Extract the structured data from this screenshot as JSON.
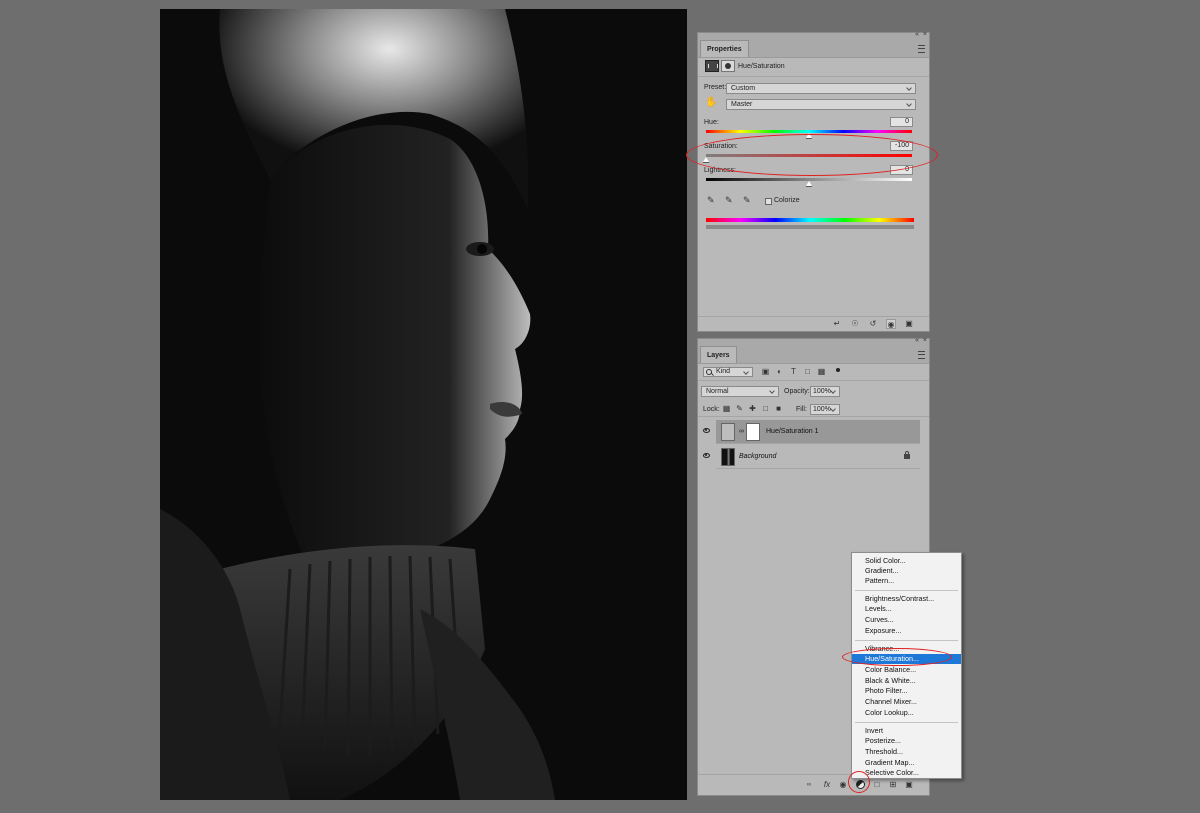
{
  "properties": {
    "tab": "Properties",
    "adjustment_title": "Hue/Saturation",
    "preset_label": "Preset:",
    "preset_value": "Custom",
    "channel_value": "Master",
    "hue_label": "Hue:",
    "hue_value": "0",
    "saturation_label": "Saturation:",
    "saturation_value": "-100",
    "lightness_label": "Lightness:",
    "lightness_value": "0",
    "colorize_label": "Colorize"
  },
  "layers": {
    "tab": "Layers",
    "kind_filter": "Kind",
    "blend_mode": "Normal",
    "opacity_label": "Opacity:",
    "opacity_value": "100%",
    "lock_label": "Lock:",
    "fill_label": "Fill:",
    "fill_value": "100%",
    "items": [
      {
        "name": "Hue/Saturation 1",
        "selected": true
      },
      {
        "name": "Background",
        "locked": true
      }
    ]
  },
  "adjustment_menu": {
    "groups": [
      [
        "Solid Color...",
        "Gradient...",
        "Pattern..."
      ],
      [
        "Brightness/Contrast...",
        "Levels...",
        "Curves...",
        "Exposure..."
      ],
      [
        "Vibrance...",
        "Hue/Saturation...",
        "Color Balance...",
        "Black & White...",
        "Photo Filter...",
        "Channel Mixer...",
        "Color Lookup..."
      ],
      [
        "Invert",
        "Posterize...",
        "Threshold...",
        "Gradient Map...",
        "Selective Color..."
      ]
    ],
    "highlighted": "Hue/Saturation..."
  },
  "colors": {
    "app_background": "#6e6e6e",
    "panel": "#b9b9b9",
    "highlight": "#1e78d7",
    "annotation": "#e02020"
  }
}
